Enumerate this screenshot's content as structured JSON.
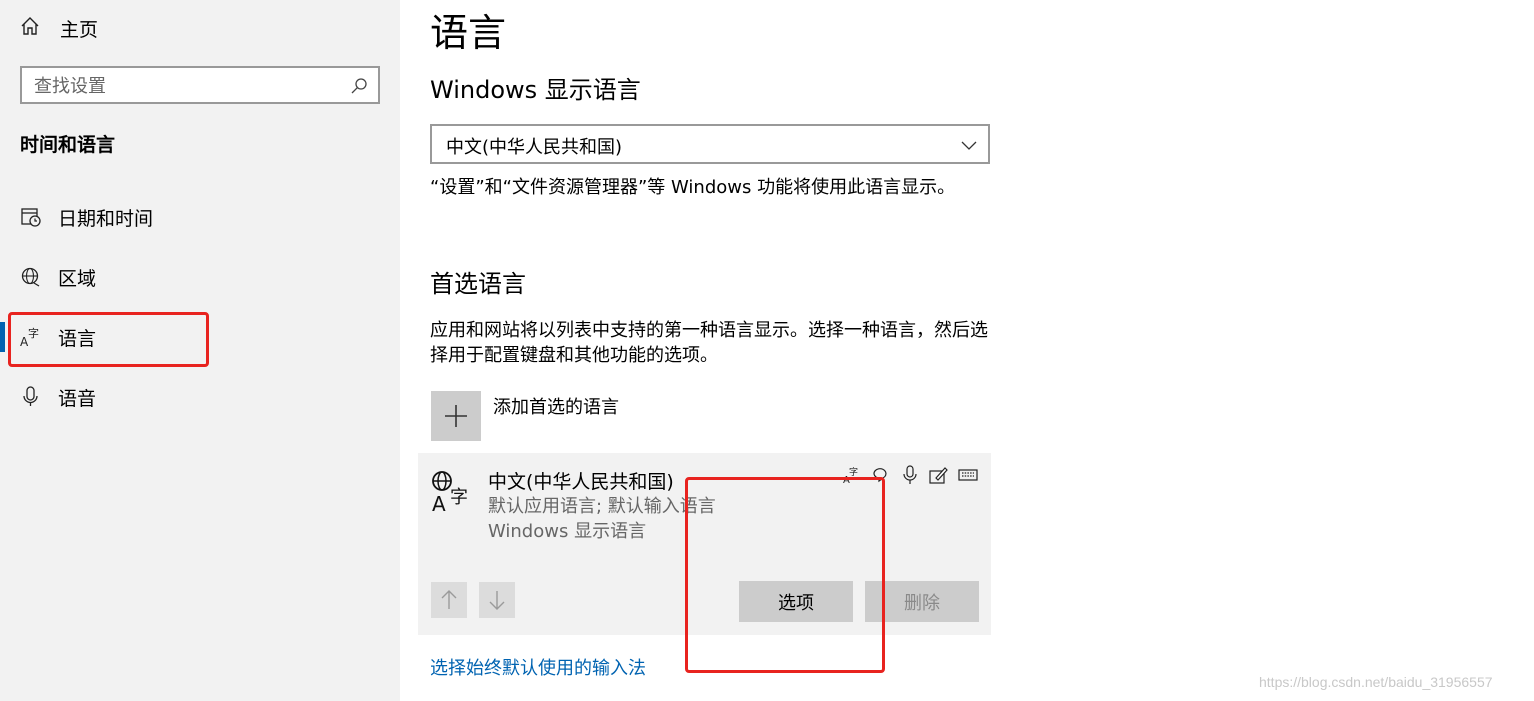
{
  "sidebar": {
    "home_label": "主页",
    "search_placeholder": "查找设置",
    "section_title": "时间和语言",
    "items": [
      {
        "label": "日期和时间",
        "icon": "calendar-clock-icon"
      },
      {
        "label": "区域",
        "icon": "globe-icon"
      },
      {
        "label": "语言",
        "icon": "language-icon",
        "active": true
      },
      {
        "label": "语音",
        "icon": "microphone-icon"
      }
    ]
  },
  "main": {
    "title": "语言",
    "display_language": {
      "heading": "Windows 显示语言",
      "selected": "中文(中华人民共和国)",
      "description": "“设置”和“文件资源管理器”等 Windows 功能将使用此语言显示。"
    },
    "preferred": {
      "heading": "首选语言",
      "description": "应用和网站将以列表中支持的第一种语言显示。选择一种语言，然后选择用于配置键盘和其他功能的选项。",
      "add_label": "添加首选的语言",
      "language": {
        "name": "中文(中华人民共和国)",
        "detail1": "默认应用语言; 默认输入语言",
        "detail2": "Windows 显示语言",
        "options_button": "选项",
        "remove_button": "删除"
      }
    },
    "input_method_link": "选择始终默认使用的输入法"
  },
  "watermark": "https://blog.csdn.net/baidu_31956557",
  "colors": {
    "accent": "#0063b1",
    "highlight": "#e8231f",
    "sidebar_bg": "#f2f2f2"
  }
}
